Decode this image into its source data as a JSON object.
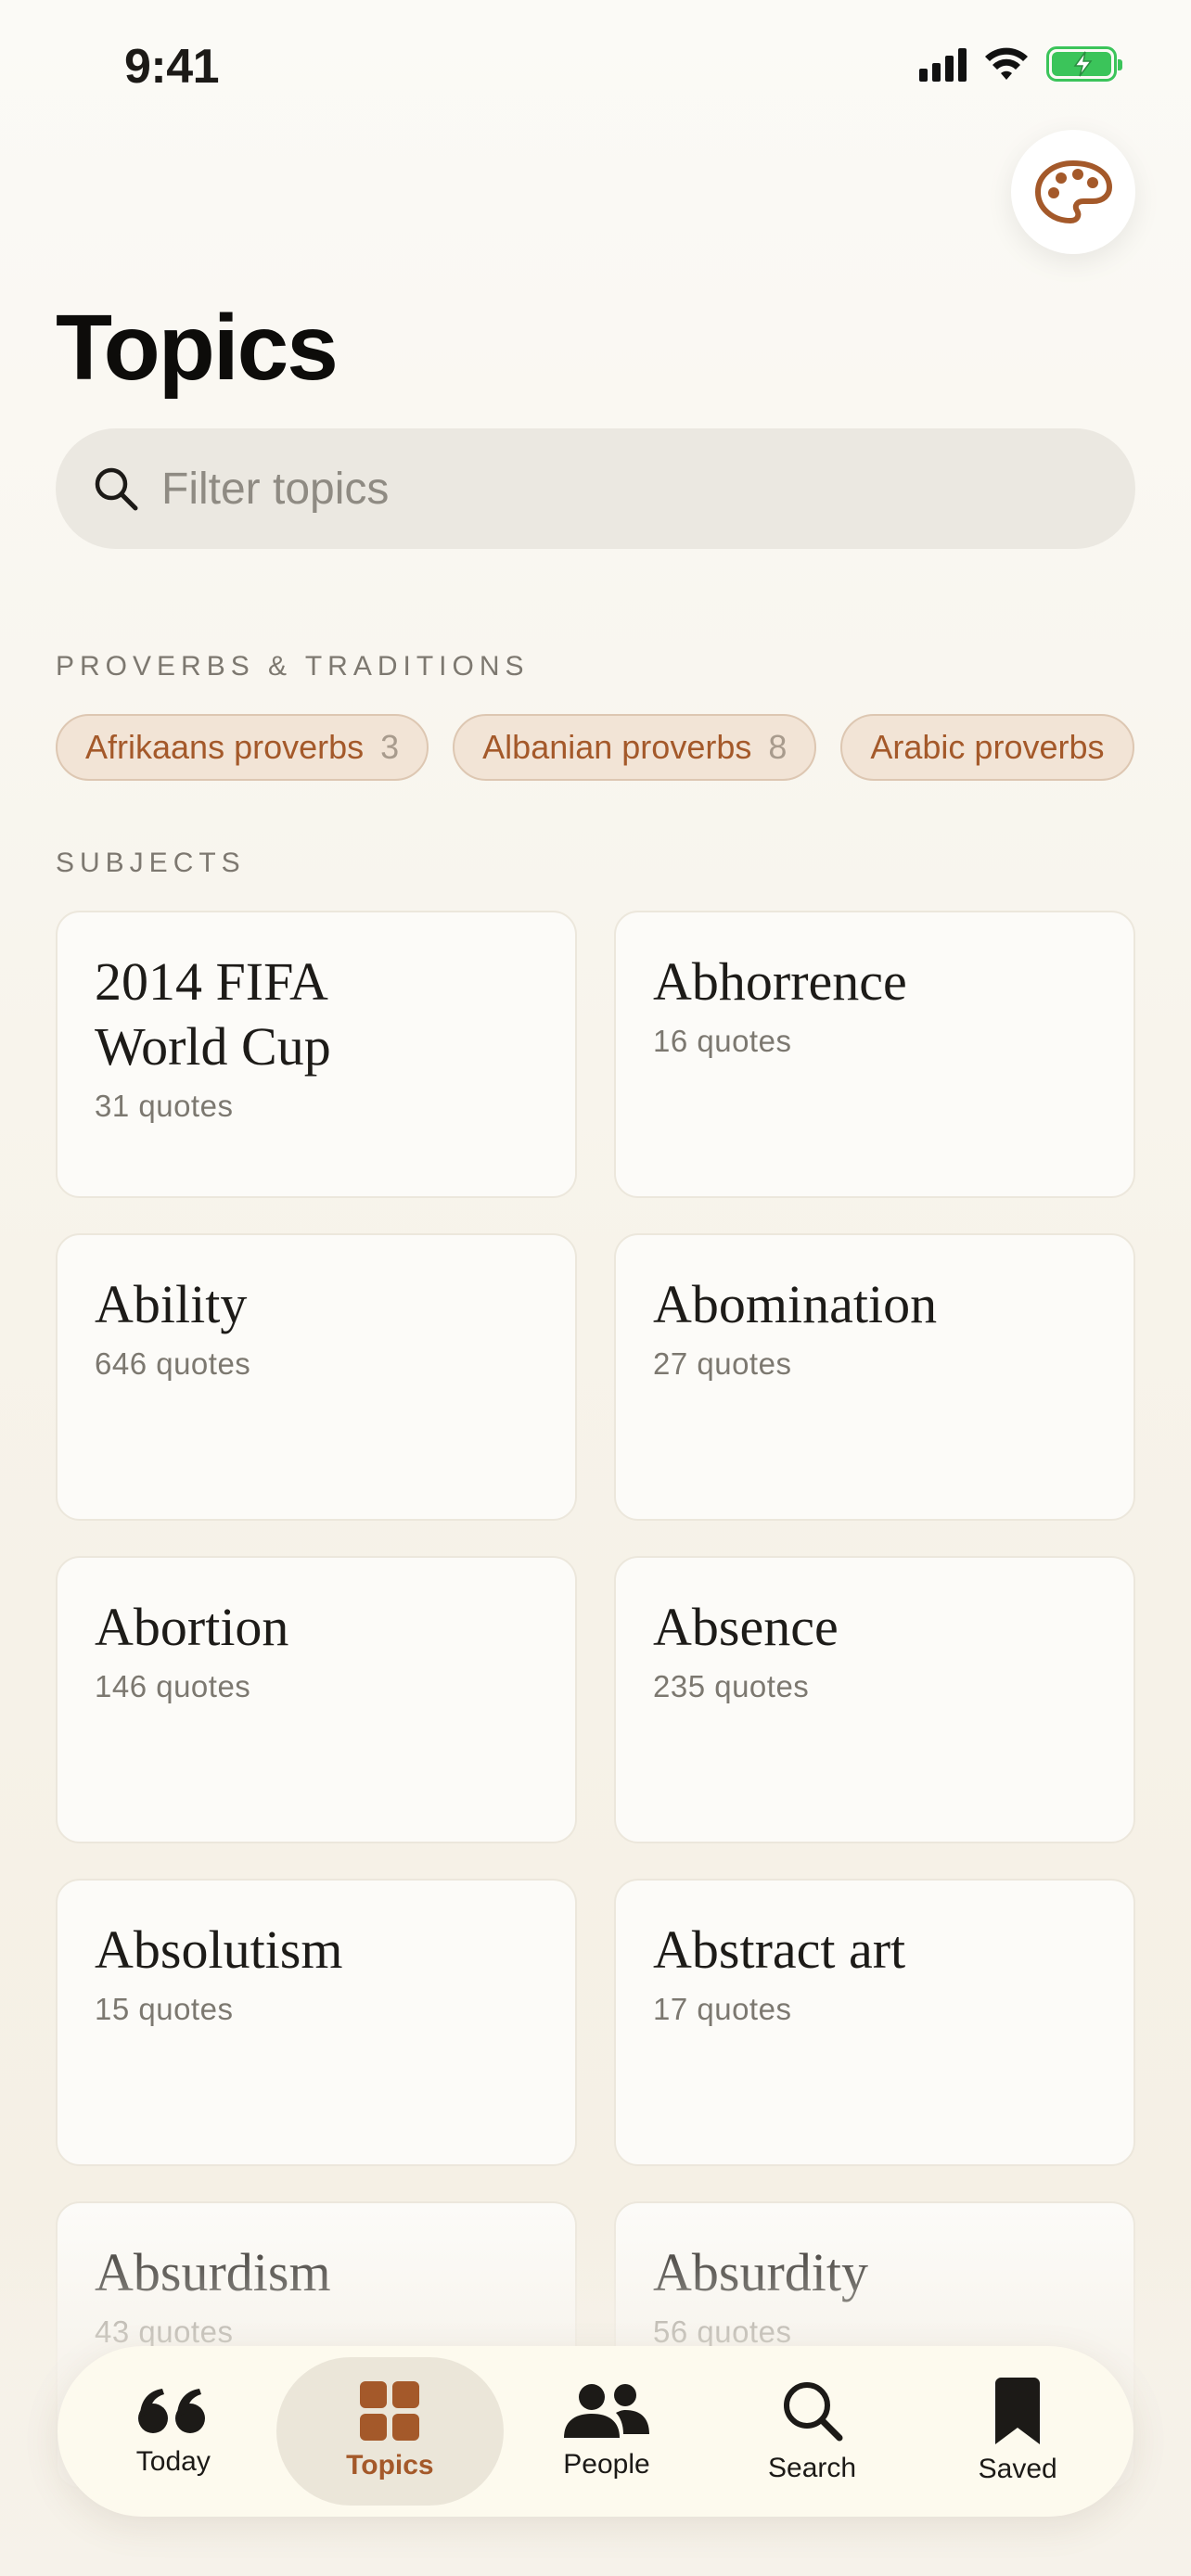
{
  "status_bar": {
    "time": "9:41"
  },
  "header": {
    "title": "Topics"
  },
  "search": {
    "placeholder": "Filter topics"
  },
  "proverbs_section": {
    "label": "PROVERBS & TRADITIONS",
    "chips": [
      {
        "label": "Afrikaans proverbs",
        "count": "3"
      },
      {
        "label": "Albanian proverbs",
        "count": "8"
      },
      {
        "label": "Arabic proverbs",
        "count": ""
      }
    ]
  },
  "subjects_section": {
    "label": "SUBJECTS",
    "topics": [
      {
        "name": "2014 FIFA World Cup",
        "count": "31 quotes"
      },
      {
        "name": "Abhorrence",
        "count": "16 quotes"
      },
      {
        "name": "Ability",
        "count": "646 quotes"
      },
      {
        "name": "Abomination",
        "count": "27 quotes"
      },
      {
        "name": "Abortion",
        "count": "146 quotes"
      },
      {
        "name": "Absence",
        "count": "235 quotes"
      },
      {
        "name": "Absolutism",
        "count": "15 quotes"
      },
      {
        "name": "Abstract art",
        "count": "17 quotes"
      },
      {
        "name": "Absurdism",
        "count": "43 quotes"
      },
      {
        "name": "Absurdity",
        "count": "56 quotes"
      }
    ]
  },
  "tab_bar": {
    "tabs": [
      {
        "label": "Today",
        "icon": "quote-icon",
        "active": false
      },
      {
        "label": "Topics",
        "icon": "grid-icon",
        "active": true
      },
      {
        "label": "People",
        "icon": "people-icon",
        "active": false
      },
      {
        "label": "Search",
        "icon": "search-icon",
        "active": false
      },
      {
        "label": "Saved",
        "icon": "bookmark-icon",
        "active": false
      }
    ]
  },
  "colors": {
    "accent": "#a4592a",
    "chip_bg": "#f2e4d6",
    "battery": "#3bc45a"
  }
}
